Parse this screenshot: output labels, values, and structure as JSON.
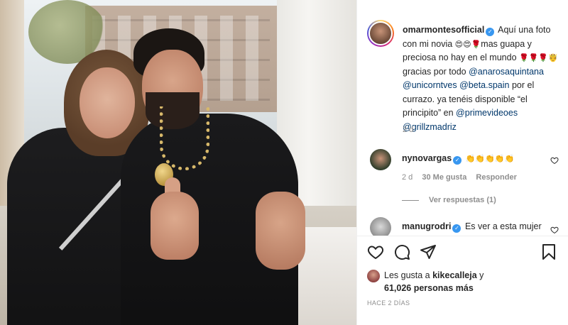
{
  "post": {
    "author": "omarmontesofficial",
    "caption_parts": [
      {
        "t": "text",
        "v": "Aquí una foto con mi novia "
      },
      {
        "t": "emoji",
        "v": "😍😍🌹"
      },
      {
        "t": "text",
        "v": "mas guapa y preciosa no hay en el mundo "
      },
      {
        "t": "emoji",
        "v": "🌹🌹🌹🤴"
      },
      {
        "t": "text",
        "v": " gracias por todo "
      },
      {
        "t": "mention",
        "v": "@anarosaquintana"
      },
      {
        "t": "text",
        "v": " "
      },
      {
        "t": "mention",
        "v": "@unicorntves"
      },
      {
        "t": "text",
        "v": " "
      },
      {
        "t": "mention",
        "v": "@beta.spain"
      },
      {
        "t": "text",
        "v": " por el currazo. ya tenéis disponible “el principito” en "
      },
      {
        "t": "mention",
        "v": "@primevideoes"
      },
      {
        "t": "text",
        "v": " "
      },
      {
        "t": "mention",
        "v": "@grillzmadriz"
      }
    ],
    "time": "2 d"
  },
  "comments": [
    {
      "user": "nynovargas",
      "verified": true,
      "text": "👏👏👏👏👏",
      "time": "2 d",
      "likes": "30 Me gusta",
      "reply": "Responder"
    },
    {
      "user": "manugrodri",
      "verified": true,
      "text": "Es ver a esta mujer"
    }
  ],
  "view_replies": "Ver respuestas (1)",
  "actions": {
    "like_icon": "heart-icon",
    "comment_icon": "comment-icon",
    "share_icon": "share-icon",
    "save_icon": "bookmark-icon"
  },
  "likes": {
    "prefix": "Les gusta a ",
    "user": "kikecalleja",
    "suffix": " y",
    "count": "61,026 personas más"
  },
  "posted_ago": "HACE 2 DÍAS"
}
